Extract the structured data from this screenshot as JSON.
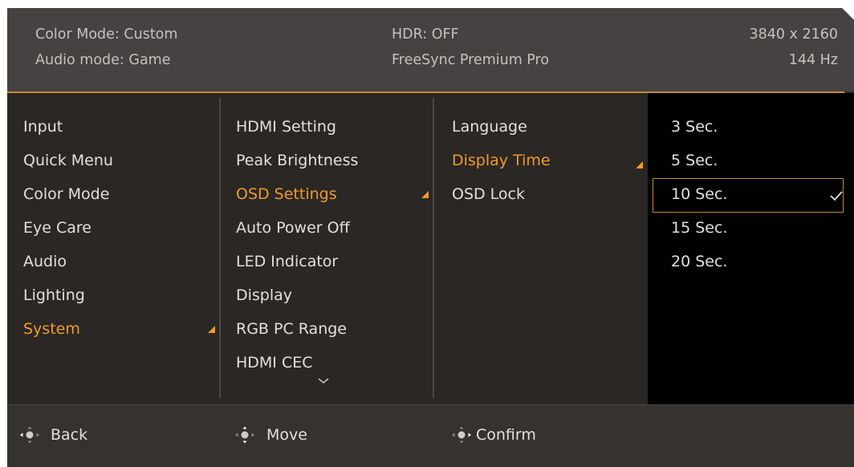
{
  "header": {
    "color_mode": "Color Mode: Custom",
    "audio_mode": "Audio mode: Game",
    "hdr": "HDR: OFF",
    "freesync": "FreeSync Premium Pro",
    "resolution": "3840 x 2160",
    "refresh": "144 Hz"
  },
  "col1": {
    "items": [
      {
        "label": "Input"
      },
      {
        "label": "Quick Menu"
      },
      {
        "label": "Color Mode"
      },
      {
        "label": "Eye Care"
      },
      {
        "label": "Audio"
      },
      {
        "label": "Lighting"
      },
      {
        "label": "System"
      }
    ],
    "active": "System"
  },
  "col2": {
    "items": [
      {
        "label": "HDMI Setting"
      },
      {
        "label": "Peak Brightness"
      },
      {
        "label": "OSD Settings"
      },
      {
        "label": "Auto Power Off"
      },
      {
        "label": "LED Indicator"
      },
      {
        "label": "Display"
      },
      {
        "label": "RGB PC Range"
      },
      {
        "label": "HDMI CEC"
      }
    ],
    "active": "OSD Settings",
    "more_icon": "chevron-down-icon"
  },
  "col3": {
    "items": [
      {
        "label": "Language"
      },
      {
        "label": "Display Time"
      },
      {
        "label": "OSD Lock"
      }
    ],
    "active": "Display Time"
  },
  "col4": {
    "options": [
      {
        "label": "3 Sec."
      },
      {
        "label": "5 Sec."
      },
      {
        "label": "10 Sec."
      },
      {
        "label": "15 Sec."
      },
      {
        "label": "20 Sec."
      }
    ],
    "selected": "10 Sec.",
    "selected_icon": "checkmark-icon"
  },
  "footer": {
    "back": "Back",
    "move": "Move",
    "confirm": "Confirm",
    "joystick_icon": "joystick-icon"
  },
  "colors": {
    "accent": "#f19a2a",
    "text": "#e3e0dc",
    "header_bg": "#464241",
    "menu_bg": "#2a2725",
    "panel_bg": "#000000",
    "footer_bg": "#363230"
  }
}
